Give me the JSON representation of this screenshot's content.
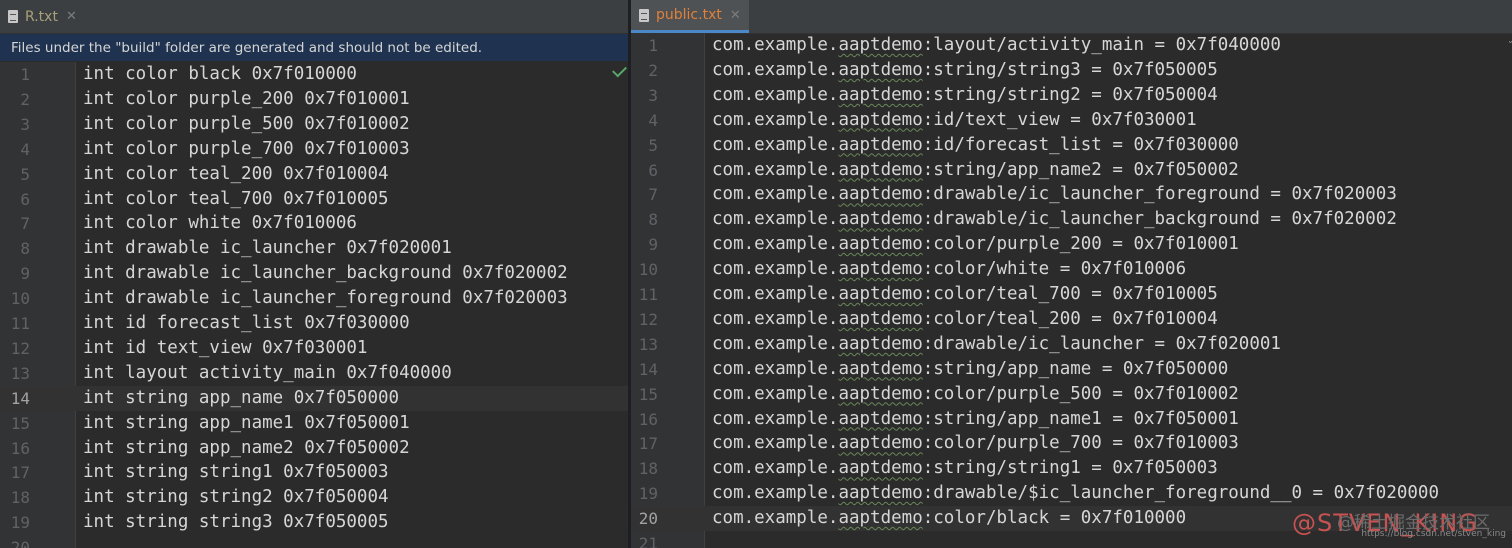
{
  "left": {
    "tab": {
      "title": "R.txt"
    },
    "banner": "Files under the \"build\" folder are generated and should not be edited.",
    "current_line": 14,
    "lines": [
      "int color black 0x7f010000",
      "int color purple_200 0x7f010001",
      "int color purple_500 0x7f010002",
      "int color purple_700 0x7f010003",
      "int color teal_200 0x7f010004",
      "int color teal_700 0x7f010005",
      "int color white 0x7f010006",
      "int drawable ic_launcher 0x7f020001",
      "int drawable ic_launcher_background 0x7f020002",
      "int drawable ic_launcher_foreground 0x7f020003",
      "int id forecast_list 0x7f030000",
      "int id text_view 0x7f030001",
      "int layout activity_main 0x7f040000",
      "int string app_name 0x7f050000",
      "int string app_name1 0x7f050001",
      "int string app_name2 0x7f050002",
      "int string string1 0x7f050003",
      "int string string2 0x7f050004",
      "int string string3 0x7f050005",
      ""
    ]
  },
  "right": {
    "tab": {
      "title": "public.txt"
    },
    "current_line": 20,
    "prefix": "com.example.",
    "package": "aaptdemo",
    "lines": [
      ":layout/activity_main = 0x7f040000",
      ":string/string3 = 0x7f050005",
      ":string/string2 = 0x7f050004",
      ":id/text_view = 0x7f030001",
      ":id/forecast_list = 0x7f030000",
      ":string/app_name2 = 0x7f050002",
      ":drawable/ic_launcher_foreground = 0x7f020003",
      ":drawable/ic_launcher_background = 0x7f020002",
      ":color/purple_200 = 0x7f010001",
      ":color/white = 0x7f010006",
      ":color/teal_700 = 0x7f010005",
      ":color/teal_200 = 0x7f010004",
      ":drawable/ic_launcher = 0x7f020001",
      ":string/app_name = 0x7f050000",
      ":color/purple_500 = 0x7f010002",
      ":string/app_name1 = 0x7f050001",
      ":color/purple_700 = 0x7f010003",
      ":string/string1 = 0x7f050003",
      ":drawable/$ic_launcher_foreground__0 = 0x7f020000",
      ":color/black = 0x7f010000",
      null
    ]
  },
  "watermark": {
    "site": "@稀土掘金技术社区",
    "url": "https://blog.csdn.net/stven_king",
    "author": "@STVEN_KING"
  }
}
